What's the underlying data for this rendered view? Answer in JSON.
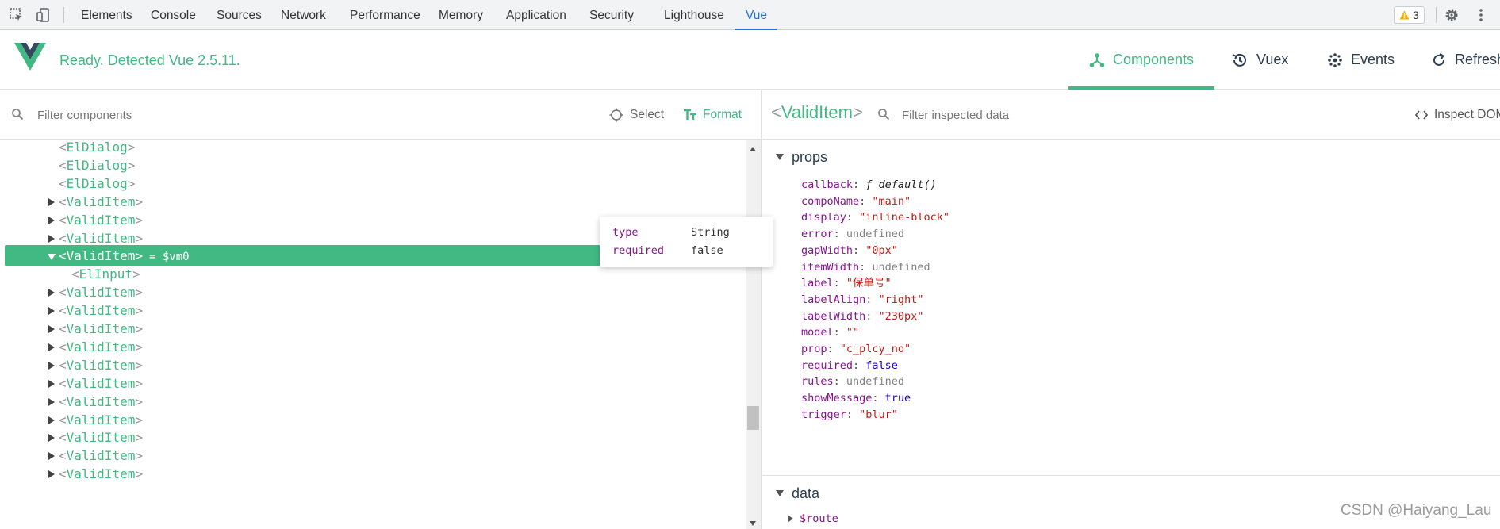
{
  "devtools": {
    "tabs": [
      "Elements",
      "Console",
      "Sources",
      "Network",
      "Performance",
      "Memory",
      "Application",
      "Security",
      "Lighthouse",
      "Vue"
    ],
    "active_tab": "Vue",
    "warning_count": "3"
  },
  "vue_header": {
    "status": "Ready. Detected Vue 2.5.11.",
    "tabs": {
      "components": "Components",
      "vuex": "Vuex",
      "events": "Events",
      "refresh": "Refresh"
    },
    "active_tab": "Components"
  },
  "components_pane": {
    "filter_placeholder": "Filter components",
    "select_label": "Select",
    "format_label": "Format",
    "tree": [
      {
        "name": "ElDialog"
      },
      {
        "name": "ElDialog"
      },
      {
        "name": "ElDialog"
      },
      {
        "name": "ValidItem"
      },
      {
        "name": "ValidItem"
      },
      {
        "name": "ValidItem"
      },
      {
        "name": "ValidItem",
        "vm_ref": "= $vm0"
      },
      {
        "name": "ElInput"
      },
      {
        "name": "ValidItem"
      },
      {
        "name": "ValidItem"
      },
      {
        "name": "ValidItem"
      },
      {
        "name": "ValidItem"
      },
      {
        "name": "ValidItem"
      },
      {
        "name": "ValidItem"
      },
      {
        "name": "ValidItem"
      },
      {
        "name": "ValidItem"
      },
      {
        "name": "ValidItem"
      },
      {
        "name": "ValidItem"
      },
      {
        "name": "ValidItem"
      }
    ]
  },
  "tooltip": {
    "rows": [
      {
        "key": "type",
        "value": "String"
      },
      {
        "key": "required",
        "value": "false"
      }
    ]
  },
  "inspector": {
    "component_name": "ValidItem",
    "filter_placeholder": "Filter inspected data",
    "inspect_dom_label": "Inspect DOM",
    "props_label": "props",
    "props": [
      {
        "key": "callback",
        "value": "ƒ default()",
        "kind": "fn"
      },
      {
        "key": "compoName",
        "value": "\"main\"",
        "kind": "str"
      },
      {
        "key": "display",
        "value": "\"inline-block\"",
        "kind": "str"
      },
      {
        "key": "error",
        "value": "undefined",
        "kind": "und"
      },
      {
        "key": "gapWidth",
        "value": "\"0px\"",
        "kind": "str"
      },
      {
        "key": "itemWidth",
        "value": "undefined",
        "kind": "und"
      },
      {
        "key": "label",
        "value": "\"保单号\"",
        "kind": "str"
      },
      {
        "key": "labelAlign",
        "value": "\"right\"",
        "kind": "str"
      },
      {
        "key": "labelWidth",
        "value": "\"230px\"",
        "kind": "str"
      },
      {
        "key": "model",
        "value": "\"\"",
        "kind": "str"
      },
      {
        "key": "prop",
        "value": "\"c_plcy_no\"",
        "kind": "str"
      },
      {
        "key": "required",
        "value": "false",
        "kind": "bool"
      },
      {
        "key": "rules",
        "value": "undefined",
        "kind": "und"
      },
      {
        "key": "showMessage",
        "value": "true",
        "kind": "bool"
      },
      {
        "key": "trigger",
        "value": "\"blur\"",
        "kind": "str"
      }
    ],
    "data_label": "data",
    "data_items": [
      "$route"
    ]
  },
  "watermark": "CSDN @Haiyang_Lau",
  "colors": {
    "vue_green": "#42b983",
    "devtools_blue": "#1a73e8",
    "prop_key": "#881391",
    "string": "#c41a16",
    "boolean": "#1c00cf"
  }
}
